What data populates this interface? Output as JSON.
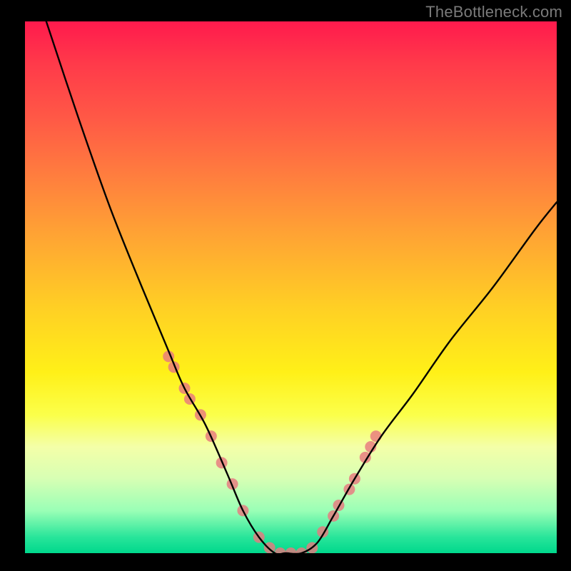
{
  "watermark": "TheBottleneck.com",
  "chart_data": {
    "type": "line",
    "title": "",
    "xlabel": "",
    "ylabel": "",
    "xlim": [
      0,
      1
    ],
    "ylim": [
      0,
      1
    ],
    "series": [
      {
        "name": "bottleneck-curve",
        "x": [
          0.04,
          0.1,
          0.16,
          0.22,
          0.27,
          0.3,
          0.34,
          0.38,
          0.41,
          0.44,
          0.47,
          0.49,
          0.52,
          0.55,
          0.58,
          0.62,
          0.67,
          0.73,
          0.8,
          0.88,
          0.96,
          1.0
        ],
        "y": [
          1.0,
          0.82,
          0.65,
          0.5,
          0.38,
          0.31,
          0.24,
          0.15,
          0.08,
          0.03,
          0.0,
          0.0,
          0.0,
          0.02,
          0.07,
          0.14,
          0.22,
          0.3,
          0.4,
          0.5,
          0.61,
          0.66
        ]
      }
    ],
    "markers": {
      "name": "highlight-dots",
      "x": [
        0.27,
        0.28,
        0.3,
        0.31,
        0.33,
        0.35,
        0.37,
        0.39,
        0.41,
        0.44,
        0.46,
        0.48,
        0.5,
        0.52,
        0.54,
        0.56,
        0.58,
        0.59,
        0.61,
        0.62,
        0.64,
        0.65,
        0.66
      ],
      "y": [
        0.37,
        0.35,
        0.31,
        0.29,
        0.26,
        0.22,
        0.17,
        0.13,
        0.08,
        0.03,
        0.01,
        0.0,
        0.0,
        0.0,
        0.01,
        0.04,
        0.07,
        0.09,
        0.12,
        0.14,
        0.18,
        0.2,
        0.22
      ],
      "color": "#e8797f",
      "radius": 8
    },
    "gradient_stops": [
      {
        "pos": 0.0,
        "color": "#ff1a4d"
      },
      {
        "pos": 0.18,
        "color": "#ff5846"
      },
      {
        "pos": 0.4,
        "color": "#ffa334"
      },
      {
        "pos": 0.66,
        "color": "#fff018"
      },
      {
        "pos": 0.8,
        "color": "#f4ffa8"
      },
      {
        "pos": 0.92,
        "color": "#9affb6"
      },
      {
        "pos": 1.0,
        "color": "#00d88c"
      }
    ]
  }
}
